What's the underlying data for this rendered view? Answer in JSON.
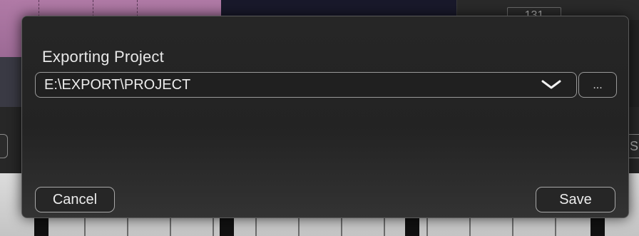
{
  "background": {
    "counter_text": "131",
    "side_label": "S"
  },
  "dialog": {
    "title": "Exporting Project",
    "path": {
      "value": "E:\\EXPORT\\PROJECT",
      "dropdown_icon": "chevron-down-icon"
    },
    "browse_label": "...",
    "cancel_label": "Cancel",
    "save_label": "Save"
  },
  "colors": {
    "dialog_bg": "#262626",
    "border": "#9a9a9a",
    "text": "#ececec",
    "pink_track": "#b07aa6"
  }
}
